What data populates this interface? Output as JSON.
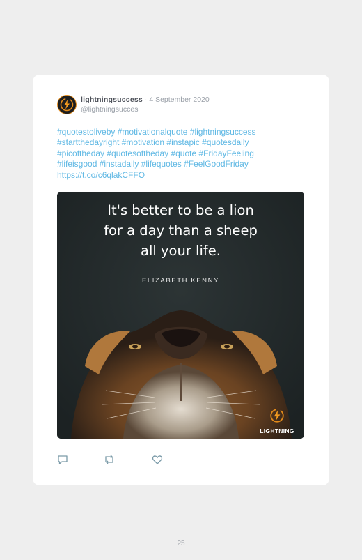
{
  "tweet": {
    "username": "lightningsuccess",
    "separator": " · ",
    "date": "4 September 2020",
    "handle": "@lightningsucces",
    "text_lines": [
      "#quotestoliveby #motivationalquote #lightningsuccess",
      "#startthedayright #motivation #instapic #quotesdaily",
      "#picoftheday #quotesoftheday #quote #FridayFeeling",
      "#lifeisgood #instadaily #lifequotes #FeelGoodFriday",
      "https://t.co/c6qlakCFFO"
    ]
  },
  "media": {
    "quote": "It's better to be a lion\nfor a day than a sheep\nall your life.",
    "author": "ELIZABETH KENNY",
    "brand": "LIGHTNING"
  },
  "actions": {
    "reply_icon": "reply-icon",
    "retweet_icon": "retweet-icon",
    "like_icon": "heart-icon"
  },
  "page": {
    "number": "25"
  },
  "colors": {
    "link": "#5fb8e4",
    "brand_orange": "#e28a1a",
    "background": "#eeeeee"
  }
}
